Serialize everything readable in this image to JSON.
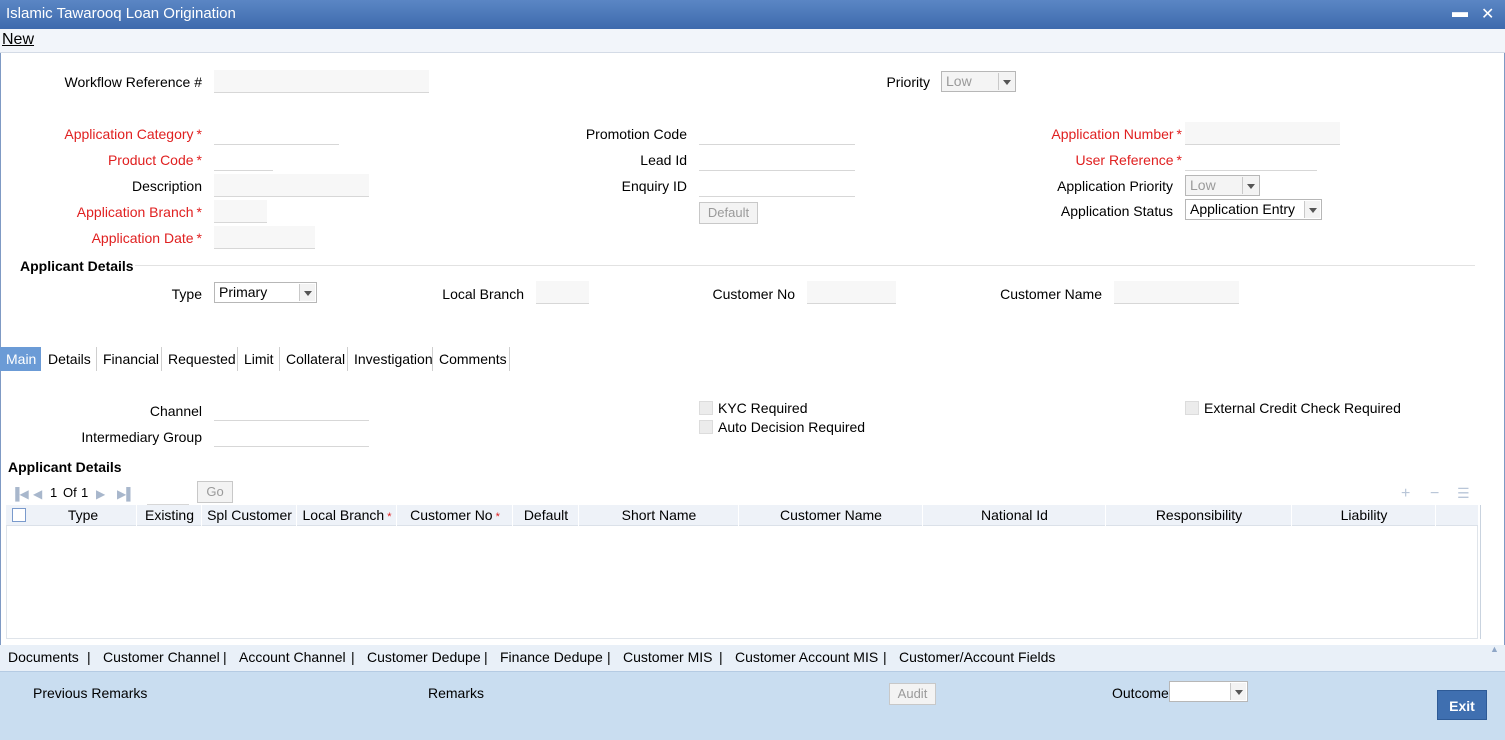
{
  "window": {
    "title": "Islamic Tawarooq Loan Origination",
    "minimize": "▬",
    "close": "✕"
  },
  "toolbar": {
    "new_label": "New"
  },
  "header": {
    "workflow_ref_label": "Workflow Reference #",
    "priority_label": "Priority",
    "priority_value": "Low"
  },
  "form": {
    "application_category_label": "Application Category",
    "product_code_label": "Product Code",
    "description_label": "Description",
    "application_branch_label": "Application Branch",
    "application_date_label": "Application Date",
    "promotion_code_label": "Promotion Code",
    "lead_id_label": "Lead Id",
    "enquiry_id_label": "Enquiry ID",
    "default_button": "Default",
    "application_number_label": "Application Number",
    "user_reference_label": "User Reference",
    "application_priority_label": "Application Priority",
    "application_priority_value": "Low",
    "application_status_label": "Application Status",
    "application_status_value": "Application Entry",
    "required_mark": "*"
  },
  "applicant": {
    "section_title": "Applicant Details",
    "type_label": "Type",
    "type_value": "Primary",
    "local_branch_label": "Local Branch",
    "customer_no_label": "Customer No",
    "customer_name_label": "Customer Name"
  },
  "tabs": [
    "Main",
    "Details",
    "Financial",
    "Requested",
    "Limit",
    "Collateral",
    "Investigation",
    "Comments"
  ],
  "main_tab": {
    "channel_label": "Channel",
    "intermediary_group_label": "Intermediary Group",
    "kyc_required_label": "KYC Required",
    "auto_decision_label": "Auto Decision Required",
    "external_credit_label": "External Credit Check Required"
  },
  "grid": {
    "title": "Applicant Details",
    "page_current": "1",
    "page_of": "Of",
    "page_total": "1",
    "go_button": "Go",
    "columns": [
      "Type",
      "Existing",
      "Spl Customer",
      "Local Branch",
      "Customer No",
      "Default",
      "Short Name",
      "Customer Name",
      "National Id",
      "Responsibility",
      "Liability"
    ]
  },
  "bottom_links": [
    "Documents",
    "Customer Channel",
    "Account Channel",
    "Customer Dedupe",
    "Finance Dedupe",
    "Customer MIS",
    "Customer Account MIS",
    "Customer/Account Fields"
  ],
  "bottom_link_separator": "|",
  "footer": {
    "previous_remarks_label": "Previous Remarks",
    "remarks_label": "Remarks",
    "audit_button": "Audit",
    "outcome_label": "Outcome",
    "exit_button": "Exit"
  },
  "colors": {
    "title_bar": "#4a77b8",
    "required": "#e02020",
    "active_tab": "#6b9bd6",
    "footer": "#c9ddf0",
    "exit": "#3f6fb0"
  }
}
